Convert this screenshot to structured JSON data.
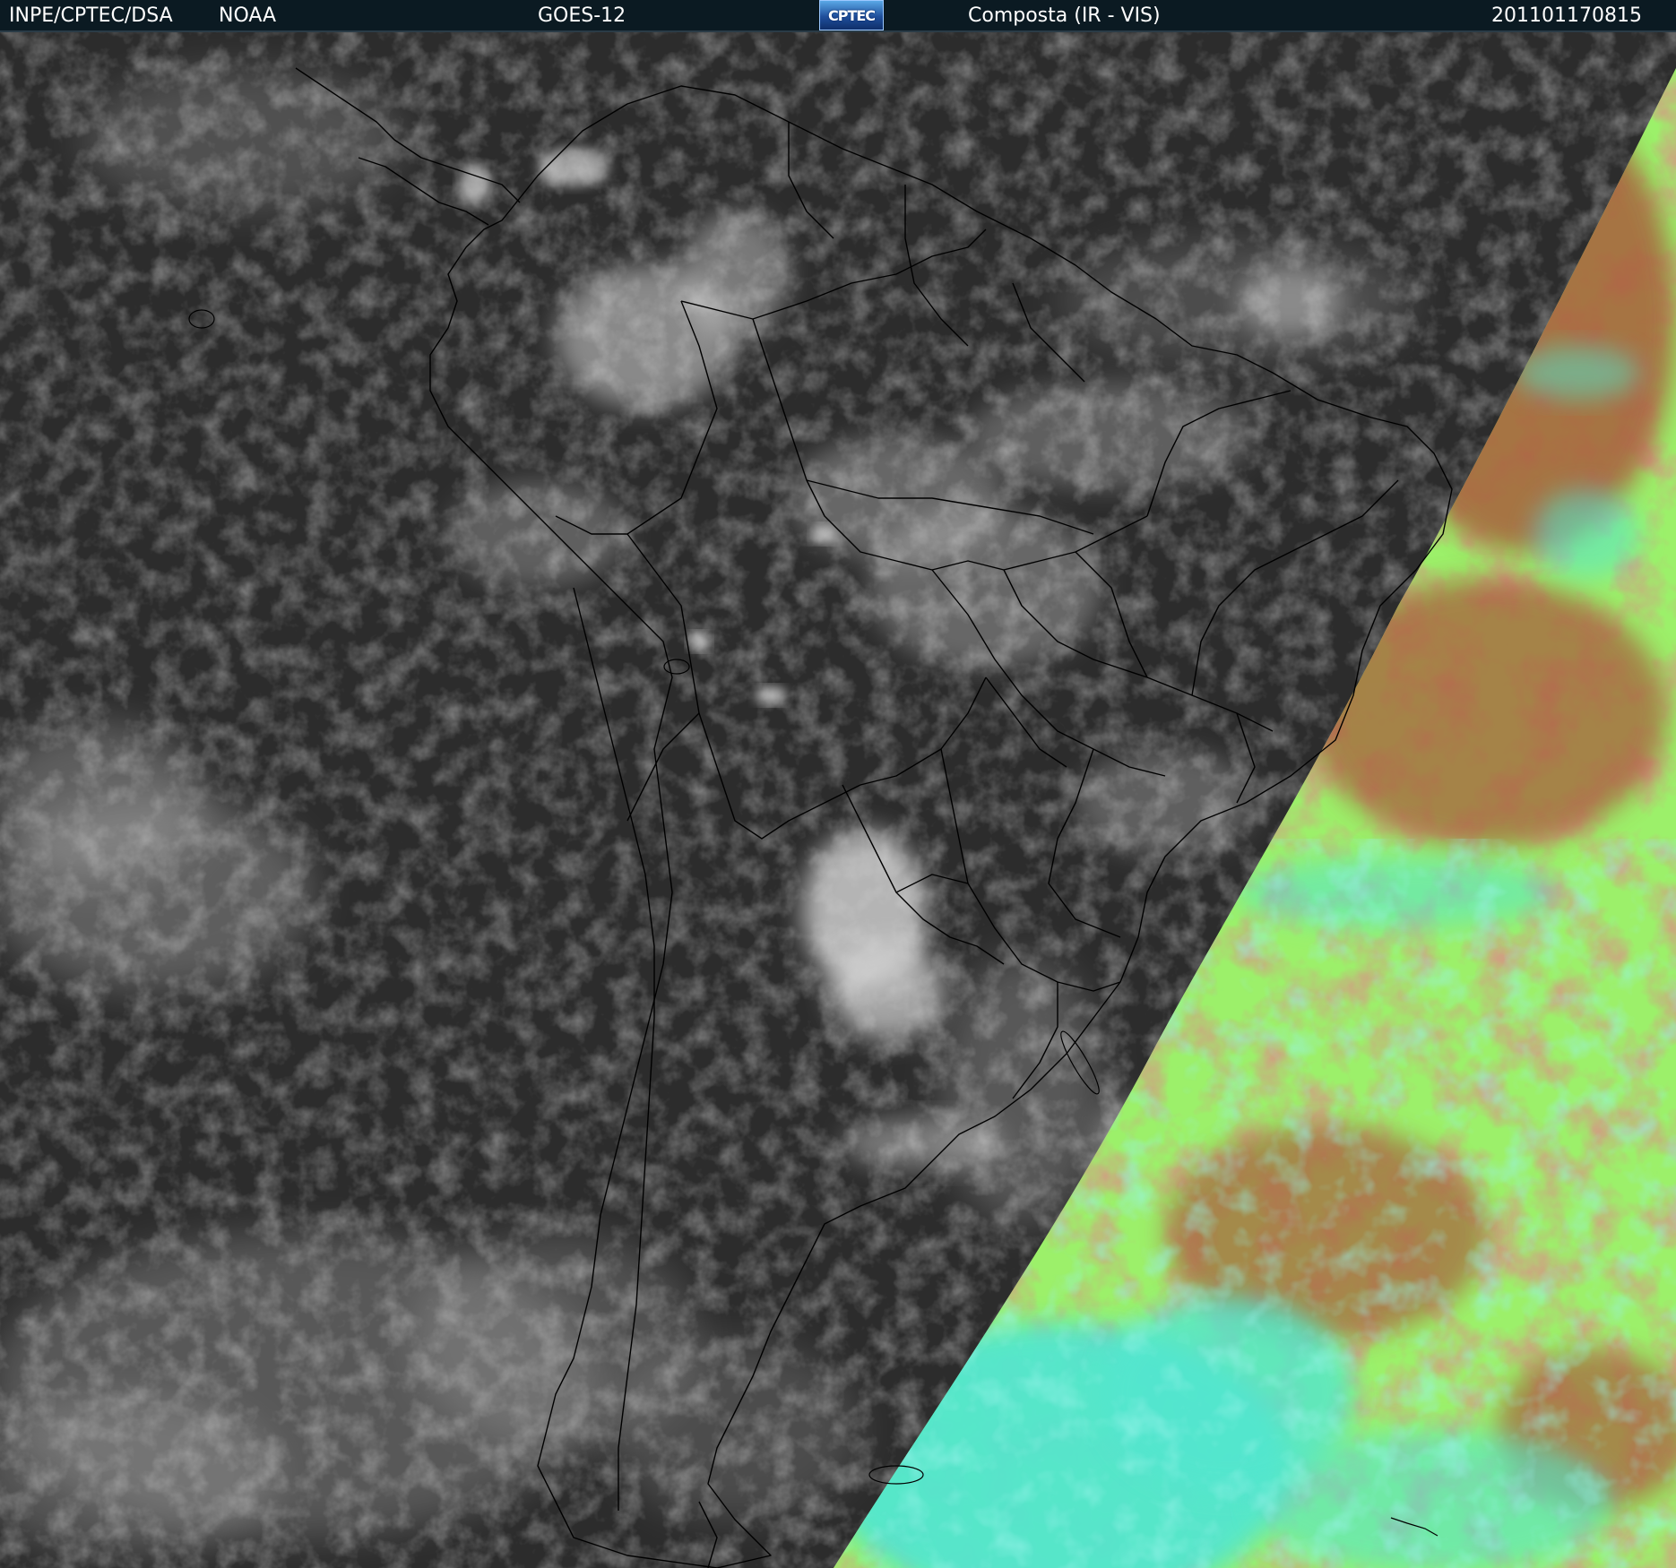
{
  "header": {
    "source": "INPE/CPTEC/DSA",
    "agency": "NOAA",
    "satellite": "GOES-12",
    "logo_text": "CPTEC",
    "product": "Composta (IR - VIS)",
    "timestamp": "201101170815"
  },
  "colors": {
    "header_background": "#0b1a22",
    "ir_background": "#2c2c2c",
    "cloud_gray": "#cfcfcf",
    "vis_green": "#9cf06a",
    "vis_red_brown": "#a0603a",
    "vis_cyan": "#52e6cf",
    "coastline": "#000000"
  },
  "map": {
    "region": "South America",
    "layers": [
      "infrared-grayscale",
      "visible-false-color",
      "country-borders",
      "state-borders"
    ]
  }
}
